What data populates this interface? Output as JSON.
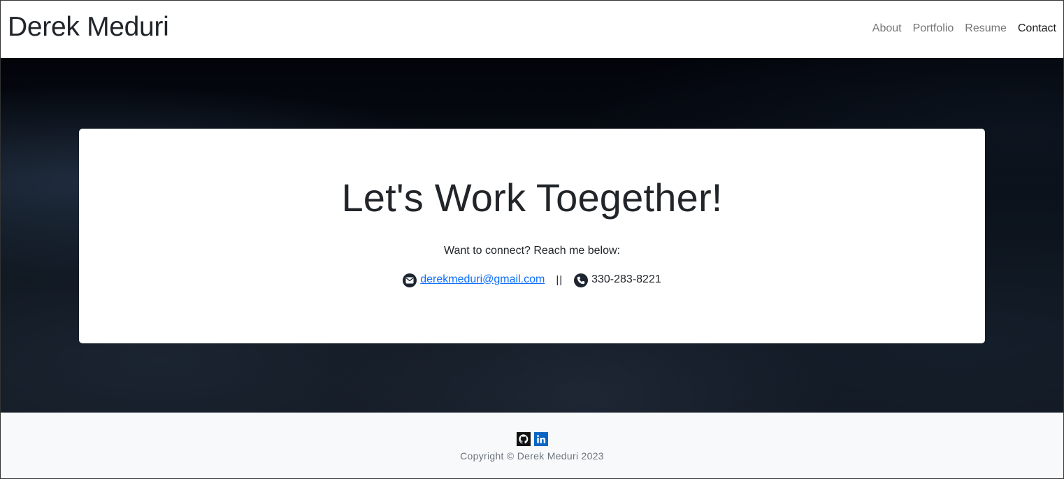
{
  "navbar": {
    "brand": "Derek Meduri",
    "links": [
      {
        "label": "About"
      },
      {
        "label": "Portfolio"
      },
      {
        "label": "Resume"
      },
      {
        "label": "Contact",
        "active": true
      }
    ]
  },
  "contact_card": {
    "headline": "Let's Work Toegether!",
    "lead": "Want to connect? Reach me below:",
    "email": "derekmeduri@gmail.com",
    "email_icon": "envelope-icon",
    "separator": "||",
    "phone": "330-283-8221",
    "phone_icon": "phone-icon"
  },
  "footer": {
    "social": [
      {
        "icon": "github-icon",
        "color": "#111111"
      },
      {
        "icon": "linkedin-icon",
        "color": "#0a66c2"
      }
    ],
    "copyright": "Copyright © Derek Meduri 2023"
  },
  "colors": {
    "link_blue": "#0d6efd",
    "text_dark": "#212529",
    "footer_bg": "#f8f9fa",
    "hero_bg": "#0a1119"
  }
}
